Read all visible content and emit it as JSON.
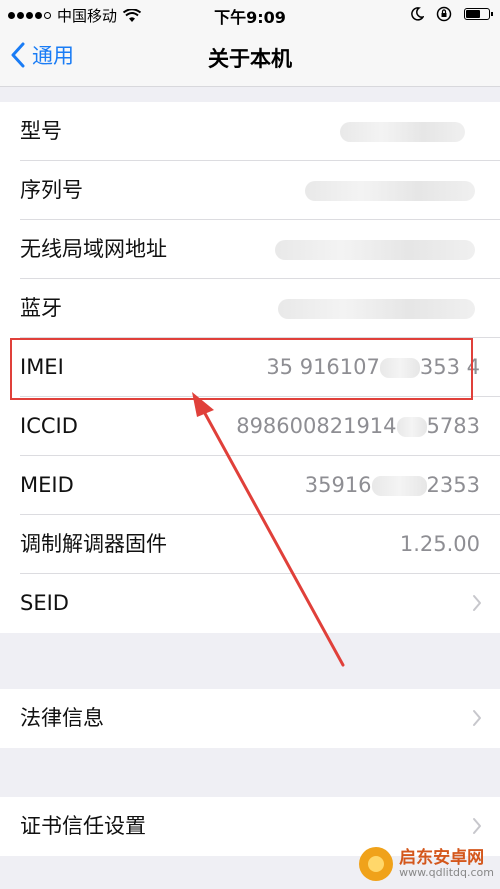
{
  "status_bar": {
    "carrier": "中国移动",
    "time": "下午9:09",
    "signal_filled": 4,
    "signal_total": 5,
    "battery_level": 0.7
  },
  "nav": {
    "back_label": "通用",
    "title": "关于本机"
  },
  "info_rows": [
    {
      "label": "型号",
      "value": ""
    },
    {
      "label": "序列号",
      "value": ""
    },
    {
      "label": "无线局域网地址",
      "value": ""
    },
    {
      "label": "蓝牙",
      "value": ""
    },
    {
      "label": "IMEI",
      "value_a": "35 916107",
      "value_b": "353 4"
    },
    {
      "label": "ICCID",
      "value_a": "898600821914",
      "value_b": "5783"
    },
    {
      "label": "MEID",
      "value_a": "35916",
      "value_b": "2353"
    },
    {
      "label": "调制解调器固件",
      "value": "1.25.00"
    },
    {
      "label": "SEID",
      "value": ""
    }
  ],
  "legal": {
    "label": "法律信息"
  },
  "cert": {
    "label": "证书信任设置"
  },
  "watermark": {
    "name": "启东安卓网",
    "url": "www.qdlitdq.com"
  },
  "colors": {
    "accent": "#1a7cf5",
    "highlight": "#e0403a",
    "secondary_text": "#8e8e93",
    "group_bg": "#efeff4"
  }
}
